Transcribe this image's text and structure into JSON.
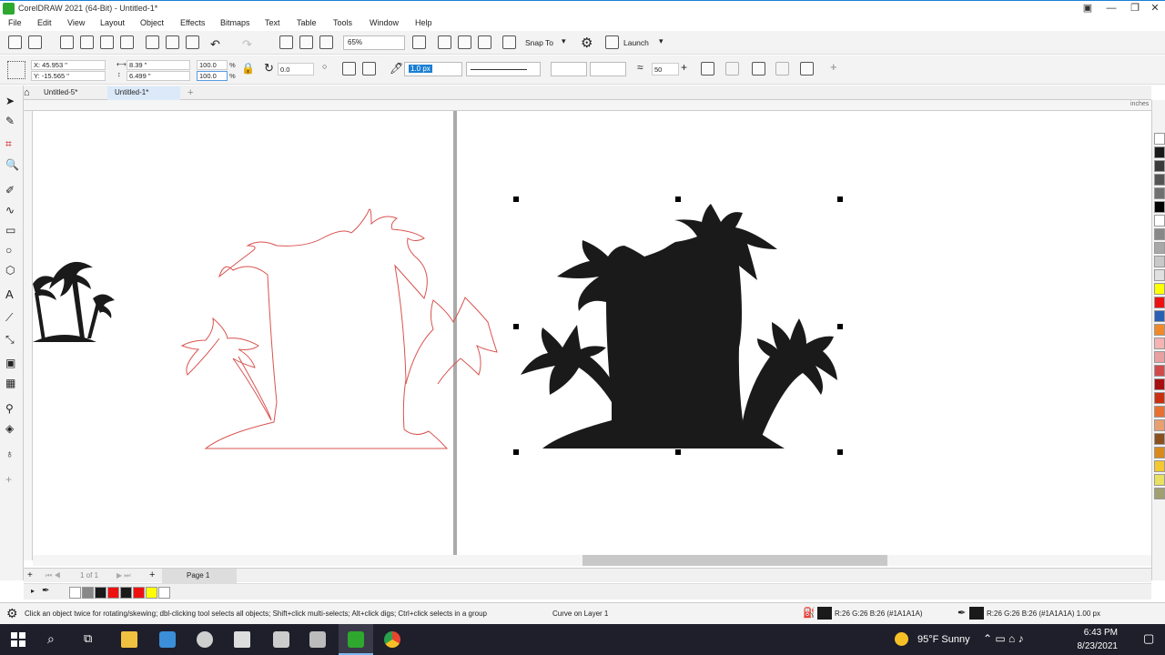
{
  "titlebar": {
    "title": "CorelDRAW 2021 (64-Bit) - Untitled-1*"
  },
  "menu": [
    "File",
    "Edit",
    "View",
    "Layout",
    "Object",
    "Effects",
    "Bitmaps",
    "Text",
    "Table",
    "Tools",
    "Window",
    "Help"
  ],
  "toolbar": {
    "zoom": "65%",
    "snap_to": "Snap To",
    "launch": "Launch"
  },
  "props": {
    "x": "X: 45.953 \"",
    "y": "Y: -15.565 \"",
    "w": "8.39 \"",
    "h": "6.499 \"",
    "sx": "100.0",
    "sy": "100.0",
    "pct": "%",
    "angle": "0.0",
    "outline_width": "1.0 px",
    "smooth": "50"
  },
  "tabs": {
    "doc1": "Untitled-5*",
    "doc2": "Untitled-1*",
    "add": "+"
  },
  "ruler": {
    "unit": "inches"
  },
  "pagebar": {
    "of": "1 of 1",
    "page": "Page 1"
  },
  "status": {
    "hint": "Click an object twice for rotating/skewing; dbl-clicking tool selects all objects; Shift+click multi-selects; Alt+click digs; Ctrl+click selects in a group",
    "object": "Curve on Layer 1",
    "fill": "R:26 G:26 B:26 (#1A1A1A)",
    "outline": "R:26 G:26 B:26 (#1A1A1A)  1.00 px"
  },
  "taskbar": {
    "weather": "95°F  Sunny",
    "time": "6:43 PM",
    "date": "8/23/2021"
  },
  "colors": {
    "palette": [
      "#ffffff",
      "#1a1a1a",
      "#3a3a3a",
      "#555555",
      "#707070",
      "#000000",
      "#ffffff",
      "#888888",
      "#a8a8a8",
      "#c8c8c8",
      "#e0e0e0",
      "#ffff00",
      "#ee1111",
      "#2a5fb4",
      "#f0892a",
      "#f6b3b3",
      "#e8a0a0",
      "#d04a4a",
      "#a81010",
      "#c83010",
      "#e87030",
      "#e8a070",
      "#8a5020",
      "#d88a1a",
      "#f4c830",
      "#e8e060",
      "#a0a070"
    ],
    "doc_palette": [
      "#ffffff",
      "#888888",
      "#1a1a1a",
      "#ee1111",
      "#1a1a1a",
      "#ee1111",
      "#ffff00",
      "#ffffff"
    ],
    "accent": "#1a7fd4",
    "outline_red": "#d9534f",
    "silhouette": "#1a1a1a"
  }
}
